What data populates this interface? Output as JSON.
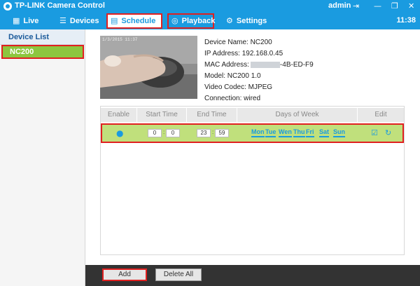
{
  "app": {
    "title": "TP-LINK Camera Control",
    "user": "admin",
    "clock": "11:38"
  },
  "nav": {
    "live": "Live",
    "devices": "Devices",
    "schedule": "Schedule",
    "playback": "Playback",
    "settings": "Settings"
  },
  "sidebar": {
    "header": "Device List",
    "items": [
      {
        "label": "NC200",
        "selected": true
      }
    ]
  },
  "device": {
    "preview_stamp": "1/3/2015 11:37",
    "name": "Device Name: NC200",
    "ip": "IP Address: 192.168.0.45",
    "mac_label": "MAC Address:",
    "mac_suffix": "-4B-ED-F9",
    "model": "Model: NC200 1.0",
    "codec": "Video Codec: MJPEG",
    "connection": "Connection: wired"
  },
  "schedule": {
    "columns": [
      "Enable",
      "Start Time",
      "End Time",
      "Days of Week",
      "Edit"
    ],
    "rows": [
      {
        "start_hour": "0",
        "start_min": "0",
        "end_hour": "23",
        "end_min": "59",
        "days": [
          "Mon",
          "Tue",
          "Wen",
          "Thu",
          "Fri",
          "Sat",
          "Sun"
        ]
      }
    ]
  },
  "buttons": {
    "add": "Add",
    "delete_all": "Delete All"
  },
  "colors": {
    "accent": "#1a9be0",
    "selected_green": "#8dc63f",
    "row_green": "#c0e07c",
    "highlight": "#e02020"
  },
  "icons": {
    "logo": "tp-link-logo",
    "logout": "logout-icon",
    "minimize": "minimize-icon",
    "restore": "restore-icon",
    "close": "close-icon",
    "live": "grid-icon",
    "devices": "list-icon",
    "schedule": "calendar-icon",
    "playback": "playback-icon",
    "settings": "gear-icon",
    "enable": "bulb-icon",
    "edit": "edit-icon",
    "refresh": "refresh-icon"
  }
}
